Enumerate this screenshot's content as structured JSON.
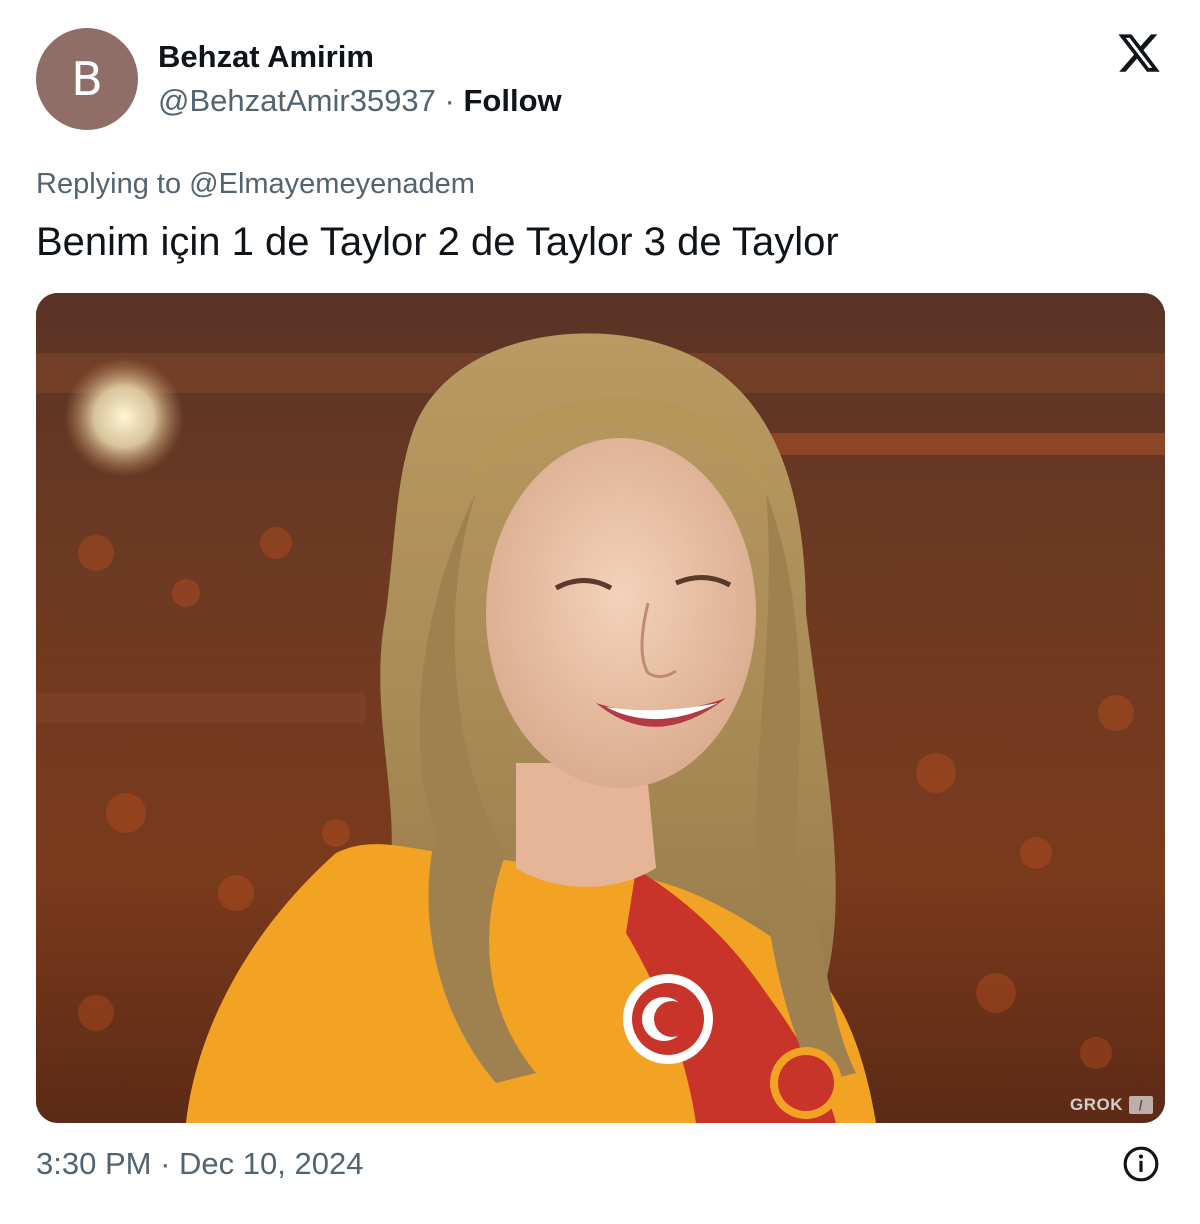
{
  "author": {
    "avatar_letter": "B",
    "avatar_color": "#8f6e67",
    "display_name": "Behzat Amirim",
    "handle": "@BehzatAmir35937",
    "separator": "·",
    "follow_label": "Follow"
  },
  "platform_icon": "x-logo-icon",
  "reply": {
    "prefix": "Replying to",
    "to_handle": "@Elmayemeyenadem"
  },
  "tweet": {
    "text": "Benim için 1 de Taylor 2 de Taylor 3 de Taylor"
  },
  "media": {
    "watermark": "GROK"
  },
  "footer": {
    "time": "3:30 PM",
    "separator": "·",
    "date": "Dec 10, 2024",
    "info_icon": "info-icon"
  },
  "colors": {
    "text_primary": "#0f1419",
    "text_secondary": "#536471",
    "jersey_yellow": "#f3a323",
    "jersey_red": "#c8342a"
  }
}
